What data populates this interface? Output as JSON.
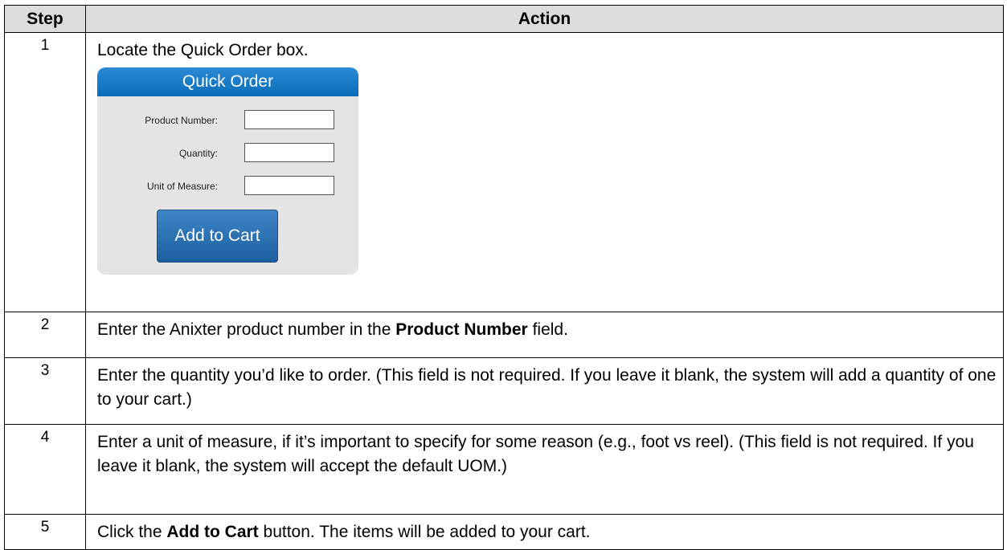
{
  "table": {
    "headers": {
      "step": "Step",
      "action": "Action"
    },
    "rows": [
      {
        "step": "1",
        "parts": [
          "Locate the Quick Order box."
        ]
      },
      {
        "step": "2",
        "parts": [
          "Enter the Anixter product number in the ",
          "Product Number",
          " field."
        ]
      },
      {
        "step": "3",
        "parts": [
          "Enter the quantity you’d like to order. (This field is not required. If you leave it blank, the system will add a quantity of one to your cart.)"
        ]
      },
      {
        "step": "4",
        "parts": [
          "Enter a unit of measure, if it’s important to specify for some reason (e.g., foot vs reel). (This field is not required. If you leave it blank, the system will accept the default UOM.)"
        ]
      },
      {
        "step": "5",
        "parts": [
          "Click the ",
          "Add to Cart",
          " button. The items will be added to your cart."
        ]
      }
    ]
  },
  "quick_order": {
    "title": "Quick Order",
    "fields": [
      {
        "label": "Product Number:",
        "value": ""
      },
      {
        "label": "Quantity:",
        "value": ""
      },
      {
        "label": "Unit of Measure:",
        "value": ""
      }
    ],
    "button": "Add to Cart"
  },
  "colors": {
    "header_bg": "#dcdcdc",
    "widget_bg": "#e4e4e4",
    "widget_header": "#0b6cb8",
    "button": "#1c5f9f"
  }
}
